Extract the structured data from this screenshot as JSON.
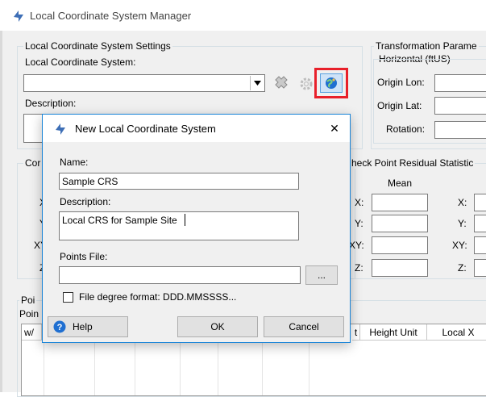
{
  "main": {
    "title": "Local Coordinate System Manager",
    "settings": {
      "group_label": "Local Coordinate System Settings",
      "lcs_label": "Local Coordinate System:",
      "lcs_value": "",
      "description_label": "Description:"
    },
    "transformation": {
      "group_label": "Transformation Parame",
      "horizontal_label": "Horizontal (ftUS)",
      "origin_lon": "Origin Lon:",
      "origin_lat": "Origin Lat:",
      "rotation": "Rotation:"
    },
    "control": {
      "group_label": "Cor",
      "rows": [
        "X",
        "Y",
        "XY",
        "Z"
      ]
    },
    "residual": {
      "group_label": "heck Point Residual Statistic",
      "mean_label": "Mean",
      "rows": [
        "X:",
        "Y:",
        "XY:",
        "Z:"
      ],
      "rows2": [
        "X:",
        "Y:",
        "XY:",
        "Z:"
      ]
    },
    "points": {
      "group_label": "Poi",
      "sub_label": "Poin",
      "columns": [
        "w/",
        "t",
        "Height Unit",
        "Local X"
      ]
    }
  },
  "dialog": {
    "title": "New Local Coordinate System",
    "close_glyph": "✕",
    "name_label": "Name:",
    "name_value": "Sample CRS",
    "description_label": "Description:",
    "description_value": "Local CRS for Sample Site",
    "points_file_label": "Points File:",
    "points_file_value": "",
    "browse_label": "...",
    "checkbox_label": "File degree format: DDD.MMSSSS...",
    "checkbox_checked": false,
    "help_label": "Help",
    "ok_label": "OK",
    "cancel_label": "Cancel"
  },
  "colors": {
    "accent": "#1f6fd1",
    "highlight": "#e8202a",
    "logo": "#3e6fb6",
    "window_bg": "#f0f0f0",
    "dialog_border": "#1883d7"
  },
  "icons": [
    "app-logo-icon",
    "dropdown-arrow-icon",
    "delete-x-icon",
    "gear-icon",
    "globe-icon",
    "close-icon",
    "help-icon"
  ]
}
